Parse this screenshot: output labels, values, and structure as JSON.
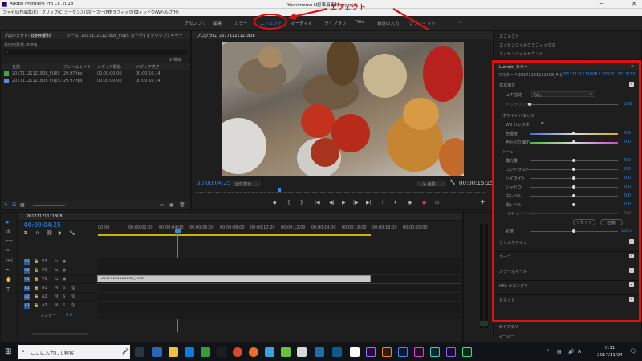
{
  "window": {
    "app_title": "Adobe Premiere Pro CC 2018",
    "project_title": "Yoshimemo.N記事用素材.prproj *",
    "buttons": {
      "minimize": "─",
      "maximize": "□",
      "close": "✕"
    }
  },
  "menu": [
    "ファイル(F)",
    "編集(E)",
    "クリップ(C)",
    "シーケンス(S)",
    "マーカー(M)",
    "グラフィック(G)",
    "ウィンドウ(W)",
    "ヘルプ(H)"
  ],
  "workspaces": [
    "アセンブリ",
    "編集",
    "カラー",
    "エフェクト",
    "オーディオ",
    "ライブラリ",
    "Title",
    "自信の入力",
    "グラフィック"
  ],
  "workspaces_more": "»",
  "annotation": {
    "label": "エフェクト",
    "color": "#e01010"
  },
  "project_panel": {
    "tabs": [
      "プロジェクト: 技術用素材",
      "ソース: 20171121121808_FUJIS",
      "オーディオクリップミキサー"
    ],
    "project_name": "技術用素材.prproj",
    "item_count": "2 項目",
    "columns": [
      "名前",
      "フレームレート",
      "メディア開始",
      "メディア終了"
    ],
    "rows": [
      {
        "name": "20171121121808_FUJIS",
        "fps": "29.97 fps",
        "start": "00:00:00:00",
        "end": "00:00:16:14",
        "color": "#3fa845"
      },
      {
        "name": "20171121121808_FUJIS.MTS",
        "fps": "29.97 fps",
        "start": "00:00:00:00",
        "end": "00:00:16:14",
        "color": "#5a8fd0"
      }
    ]
  },
  "program_monitor": {
    "title": "プログラム: 20171121121808",
    "timecode_current": "00:00:04:25",
    "fit": "全体表示",
    "quality": "1/4 画質",
    "timecode_end": "00:00:15:15"
  },
  "timeline": {
    "sequence_tab": "20171121121808",
    "timecode": "00:00:04:25",
    "ruler": [
      "00:00",
      "00:00:02:00",
      "00:00:04:00",
      "00:00:06:00",
      "00:00:08:00",
      "00:00:10:00",
      "00:00:12:00",
      "00:00:14:00",
      "00:00:16:00",
      "00:00:18:00",
      "00:00:20:00"
    ],
    "video_tracks": [
      "V3",
      "V2",
      "V1"
    ],
    "audio_tracks": [
      "A1",
      "A2",
      "A3"
    ],
    "master_label": "マスター",
    "master_value": "0.0",
    "clip_label": "20171121121808_FUJIS"
  },
  "effects_panel": {
    "items_top": [
      "エフェクト",
      "エッセンシャルグラフィックス",
      "エッセンシャルサウンド"
    ],
    "lumetri_title": "Lumetri カラー",
    "master_source": "マスター * 20171121121808_FUJIS",
    "clip_source": "20171121121808 * 20171121121808...",
    "basic_section": "基本補正",
    "lut_label": "LUT 設定",
    "lut_value": "なし",
    "intensity_label": "インテンシティ",
    "intensity_value": "100",
    "white_balance": "ホワイトバランス",
    "wb_selector": "WB セレクター",
    "temperature_label": "色温度",
    "temperature_value": "0.0",
    "tint_label": "色かぶり補正",
    "tint_value": "0.0",
    "tone": "トーン",
    "tone_rows": [
      {
        "label": "露光量",
        "value": "0.0"
      },
      {
        "label": "コントラスト",
        "value": "0.0"
      },
      {
        "label": "ハイライト",
        "value": "0.0"
      },
      {
        "label": "シャドウ",
        "value": "0.0"
      },
      {
        "label": "白レベル",
        "value": "0.0"
      },
      {
        "label": "黒レベル",
        "value": "0.0"
      },
      {
        "label": "HDR ハイライト",
        "value": "0.0"
      }
    ],
    "reset_button": "リセット",
    "auto_button": "自動",
    "saturation_label": "彩度",
    "saturation_value": "100.0",
    "sections": [
      "クリエイティブ",
      "カーブ",
      "カラーホイール",
      "HSL セカンダリ",
      "ビネット"
    ],
    "items_bottom": [
      "ライブラリ",
      "マーカー"
    ]
  },
  "taskbar": {
    "search_placeholder": "ここに入力して検索",
    "time": "0:11",
    "date": "2017/11/24"
  }
}
